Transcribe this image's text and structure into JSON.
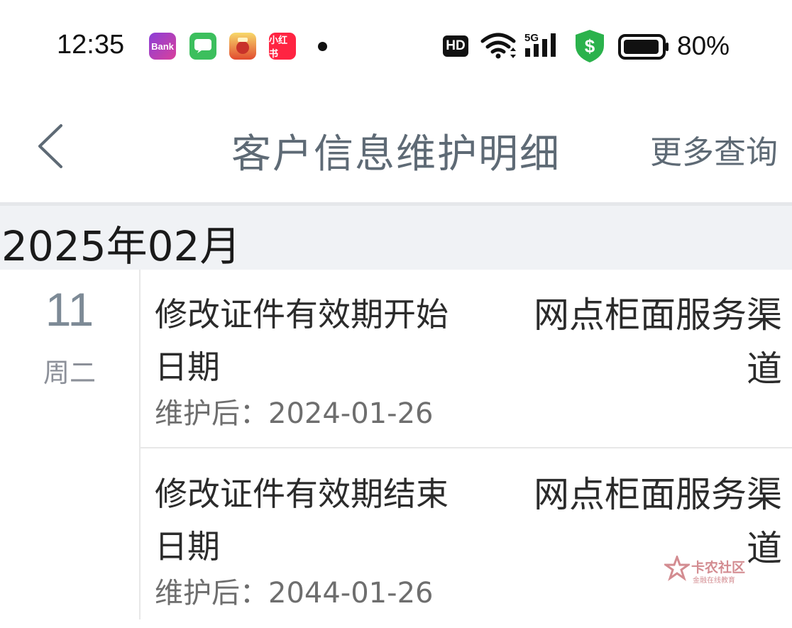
{
  "status_bar": {
    "time": "12:35",
    "app_icons": [
      "bank-app-icon",
      "messages-app-icon",
      "game-app-icon",
      "xiaohongshu-app-icon"
    ],
    "bank_icon_text": "Bank",
    "xhs_icon_text": "小红书",
    "hd_label": "HD",
    "network_label": "5G",
    "battery_percent": "80%"
  },
  "nav": {
    "back_icon": "chevron-left-icon",
    "title": "客户信息维护明细",
    "more_query": "更多查询"
  },
  "month_header": "2025年02月",
  "date": {
    "day": "11",
    "weekday": "周二"
  },
  "records": [
    {
      "title": "修改证件有效期开始日期",
      "channel": "网点柜面服务渠道",
      "after_label": "维护后：",
      "after_value": "2024-01-26"
    },
    {
      "title": "修改证件有效期结束日期",
      "channel": "网点柜面服务渠道",
      "after_label": "维护后：",
      "after_value": "2044-01-26"
    }
  ],
  "watermark": {
    "name": "卡农社区",
    "sub": "金融在线教育"
  },
  "colors": {
    "title_gray": "#5e6a75",
    "month_bg": "#f0f2f5",
    "shield_green": "#2bb24c"
  }
}
